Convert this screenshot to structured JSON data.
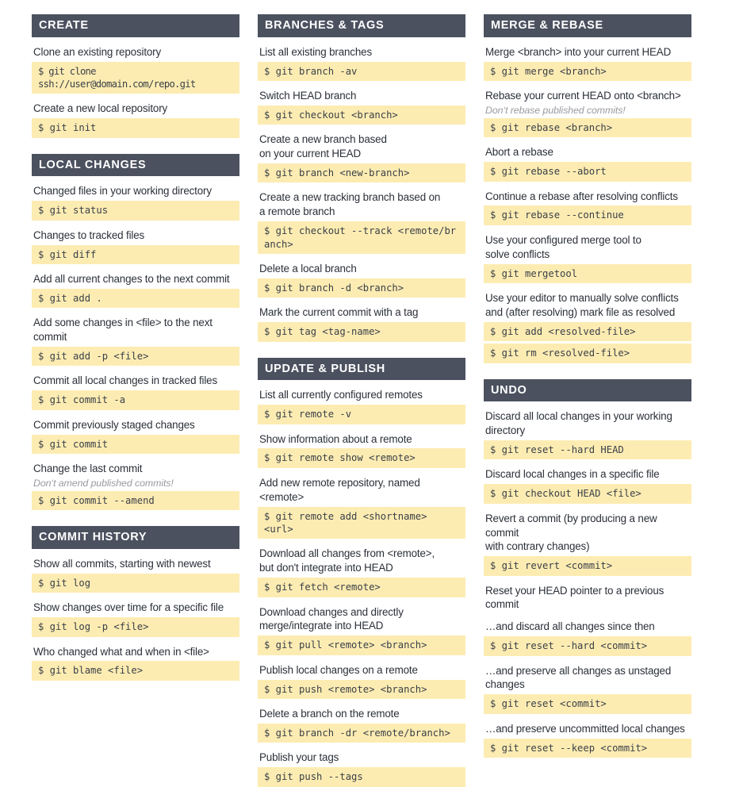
{
  "columns": [
    {
      "name": "left",
      "sections": [
        {
          "title": "CREATE",
          "entries": [
            {
              "desc": "Clone an existing repository",
              "cmds": [
                "$ git clone ssh://user@domain.com/repo.git"
              ],
              "tight": true
            },
            {
              "desc": "Create a new local repository",
              "cmds": [
                "$ git init"
              ]
            }
          ]
        },
        {
          "title": "LOCAL CHANGES",
          "entries": [
            {
              "desc": "Changed files in your working directory",
              "cmds": [
                "$ git status"
              ]
            },
            {
              "desc": "Changes to tracked files",
              "cmds": [
                "$ git diff"
              ]
            },
            {
              "desc": "Add all current changes to the next commit",
              "cmds": [
                "$ git add ."
              ]
            },
            {
              "desc": "Add some changes in <file> to the next commit",
              "cmds": [
                "$ git add -p <file>"
              ]
            },
            {
              "desc": "Commit all local changes in tracked files",
              "cmds": [
                "$ git commit -a"
              ]
            },
            {
              "desc": "Commit previously staged changes",
              "cmds": [
                "$ git commit"
              ]
            },
            {
              "desc": "Change the last commit",
              "warn": "Don‘t amend published commits!",
              "cmds": [
                "$ git commit --amend"
              ]
            }
          ]
        },
        {
          "title": "COMMIT HISTORY",
          "entries": [
            {
              "desc": "Show all commits, starting with newest",
              "cmds": [
                "$ git log"
              ]
            },
            {
              "desc": "Show changes over time for a specific file",
              "cmds": [
                "$ git log -p <file>"
              ]
            },
            {
              "desc": "Who changed what and when in <file>",
              "cmds": [
                "$ git blame <file>"
              ]
            }
          ]
        }
      ]
    },
    {
      "name": "middle",
      "sections": [
        {
          "title": "BRANCHES & TAGS",
          "entries": [
            {
              "desc": "List all existing branches",
              "cmds": [
                "$ git branch -av"
              ]
            },
            {
              "desc": "Switch HEAD branch",
              "cmds": [
                "$ git checkout <branch>"
              ]
            },
            {
              "desc": "Create a new branch based\non your current HEAD",
              "cmds": [
                "$ git branch <new-branch>"
              ]
            },
            {
              "desc": "Create a new tracking branch based on\na remote branch",
              "cmds": [
                "$ git checkout --track <remote/branch>"
              ],
              "wrap": true
            },
            {
              "desc": "Delete a local branch",
              "cmds": [
                "$ git branch -d <branch>"
              ]
            },
            {
              "desc": "Mark the current commit with a tag",
              "cmds": [
                "$ git tag <tag-name>"
              ]
            }
          ]
        },
        {
          "title": "UPDATE & PUBLISH",
          "entries": [
            {
              "desc": "List all currently configured remotes",
              "cmds": [
                "$ git remote -v"
              ]
            },
            {
              "desc": "Show information about a remote",
              "cmds": [
                "$ git remote show <remote>"
              ]
            },
            {
              "desc": "Add new remote repository, named <remote>",
              "cmds": [
                "$ git remote add <shortname> <url>"
              ]
            },
            {
              "desc": "Download all changes from <remote>,\nbut don't integrate into HEAD",
              "cmds": [
                "$ git fetch <remote>"
              ]
            },
            {
              "desc": "Download changes and directly\nmerge/integrate into  HEAD",
              "cmds": [
                "$ git pull <remote> <branch>"
              ]
            },
            {
              "desc": "Publish local changes on a remote",
              "cmds": [
                "$ git push <remote> <branch>"
              ]
            },
            {
              "desc": "Delete a branch on the remote",
              "cmds": [
                "$ git branch -dr <remote/branch>"
              ]
            },
            {
              "desc": "Publish your tags",
              "cmds": [
                "$ git push --tags"
              ]
            }
          ]
        }
      ]
    },
    {
      "name": "right",
      "sections": [
        {
          "title": "MERGE & REBASE",
          "entries": [
            {
              "desc": "Merge <branch> into your current HEAD",
              "cmds": [
                "$ git merge <branch>"
              ]
            },
            {
              "desc": "Rebase your current HEAD onto <branch>",
              "warn": "Don‘t rebase published commits!",
              "cmds": [
                "$ git rebase <branch>"
              ]
            },
            {
              "desc": "Abort a rebase",
              "cmds": [
                "$ git rebase --abort"
              ]
            },
            {
              "desc": "Continue a rebase after resolving conflicts",
              "cmds": [
                "$ git rebase --continue"
              ]
            },
            {
              "desc": "Use your configured merge tool to\nsolve conflicts",
              "cmds": [
                "$ git mergetool"
              ]
            },
            {
              "desc": "Use your editor to manually solve conflicts\nand (after resolving) mark file as resolved",
              "cmds": [
                "$ git add <resolved-file>",
                "$ git rm <resolved-file>"
              ]
            }
          ]
        },
        {
          "title": "UNDO",
          "entries": [
            {
              "desc": "Discard all local changes in your working\ndirectory",
              "cmds": [
                "$ git reset --hard HEAD"
              ]
            },
            {
              "desc": "Discard local changes in a specific file",
              "cmds": [
                "$ git checkout HEAD <file>"
              ]
            },
            {
              "desc": "Revert a commit (by producing a new commit\nwith contrary changes)",
              "cmds": [
                "$ git revert <commit>"
              ]
            },
            {
              "desc": "Reset your HEAD pointer to a previous commit",
              "cmds": []
            },
            {
              "desc": "…and discard all changes since then",
              "cmds": [
                "$ git reset --hard <commit>"
              ]
            },
            {
              "desc": "…and preserve all changes as unstaged\nchanges",
              "cmds": [
                "$ git reset <commit>"
              ]
            },
            {
              "desc": "…and preserve uncommitted local changes",
              "cmds": [
                "$ git reset --keep <commit>"
              ]
            }
          ]
        }
      ]
    }
  ]
}
